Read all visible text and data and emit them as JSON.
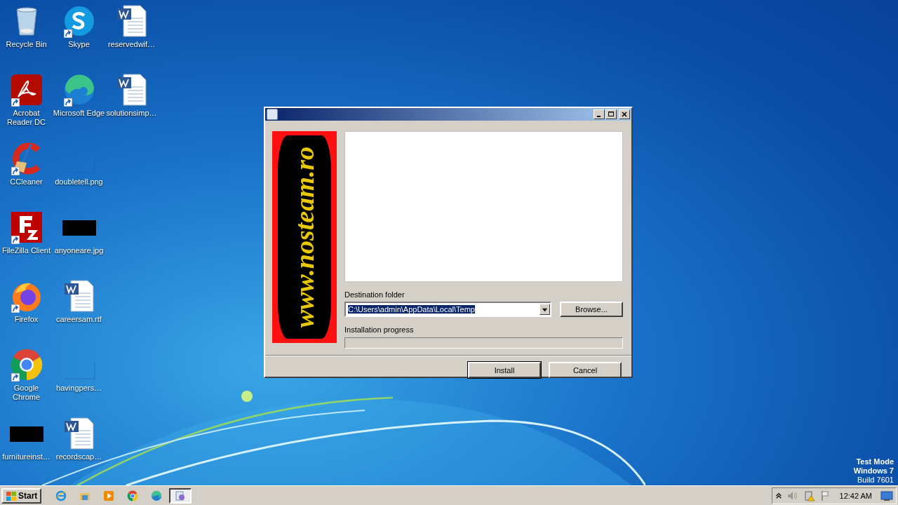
{
  "desktop": {
    "icons": [
      {
        "label": "Recycle Bin",
        "kind": "recycle",
        "shortcut": false
      },
      {
        "label": "Acrobat Reader DC",
        "kind": "acrobat",
        "shortcut": true
      },
      {
        "label": "CCleaner",
        "kind": "ccleaner",
        "shortcut": true
      },
      {
        "label": "FileZilla Client",
        "kind": "filezilla",
        "shortcut": true
      },
      {
        "label": "Firefox",
        "kind": "firefox",
        "shortcut": true
      },
      {
        "label": "Google Chrome",
        "kind": "chrome",
        "shortcut": true
      },
      {
        "label": "furnitureinst…",
        "kind": "dark",
        "shortcut": false
      },
      {
        "label": "Skype",
        "kind": "skype",
        "shortcut": true
      },
      {
        "label": "Microsoft Edge",
        "kind": "edge",
        "shortcut": true
      },
      {
        "label": "doubletell.png",
        "kind": "blank",
        "shortcut": false
      },
      {
        "label": "anyoneare.jpg",
        "kind": "dark",
        "shortcut": false
      },
      {
        "label": "careersam.rtf",
        "kind": "word",
        "shortcut": false
      },
      {
        "label": "havingpers…",
        "kind": "blank",
        "shortcut": false
      },
      {
        "label": "recordscap…",
        "kind": "word",
        "shortcut": false
      },
      {
        "label": "reservedwif…",
        "kind": "word",
        "shortcut": false
      },
      {
        "label": "solutionsimp…",
        "kind": "word",
        "shortcut": false
      }
    ],
    "os_notice": [
      "Test Mode",
      "Windows 7",
      "Build 7601"
    ]
  },
  "dialog": {
    "banner_text": "www.nosteam.ro",
    "destination": {
      "label": "Destination folder",
      "value": "C:\\Users\\admin\\AppData\\Local\\Temp",
      "selected": true
    },
    "browse_button": "Browse...",
    "progress": {
      "label": "Installation progress",
      "level": 0
    },
    "buttons": [
      {
        "label": "Install",
        "default": true
      },
      {
        "label": "Cancel",
        "default": false
      }
    ]
  },
  "taskbar": {
    "start": "Start",
    "apps": [
      {
        "kind": "ie",
        "active": false
      },
      {
        "kind": "explorer",
        "active": false
      },
      {
        "kind": "media",
        "active": false
      },
      {
        "kind": "chrome",
        "active": false
      },
      {
        "kind": "edge",
        "active": false
      },
      {
        "kind": "installer",
        "active": true
      }
    ],
    "clock": "12:42 AM"
  }
}
